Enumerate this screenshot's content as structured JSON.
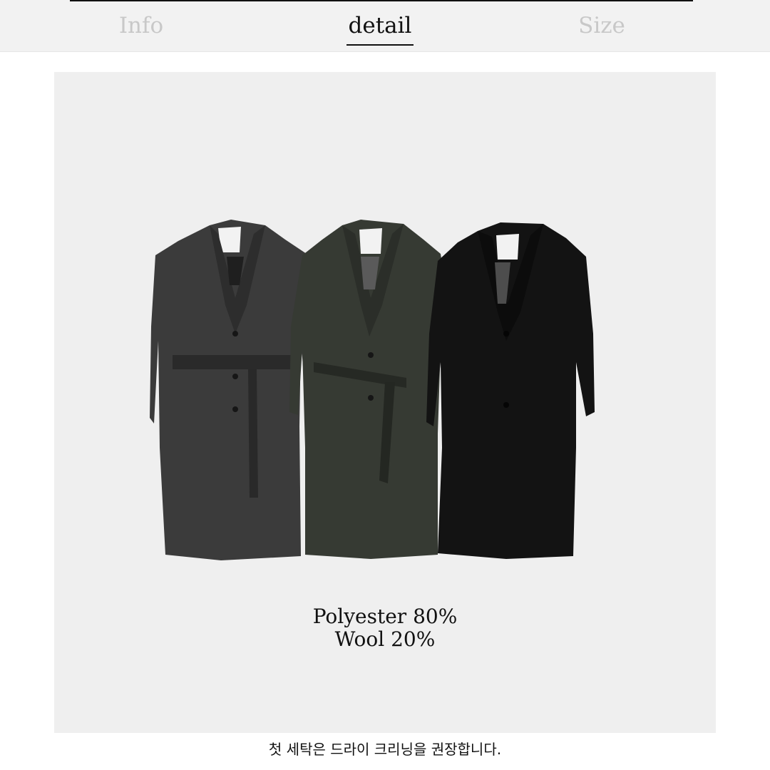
{
  "tabs": [
    {
      "label": "Info",
      "active": false
    },
    {
      "label": "detail",
      "active": true
    },
    {
      "label": "Size",
      "active": false
    }
  ],
  "product": {
    "image": "three-long-belted-coats",
    "colors": [
      "#3a3a3a",
      "#353831",
      "#121212"
    ],
    "material_lines": [
      "Polyester 80%",
      "Wool 20%"
    ]
  },
  "care_note": "첫 세탁은 드라이 크리닝을 권장합니다."
}
